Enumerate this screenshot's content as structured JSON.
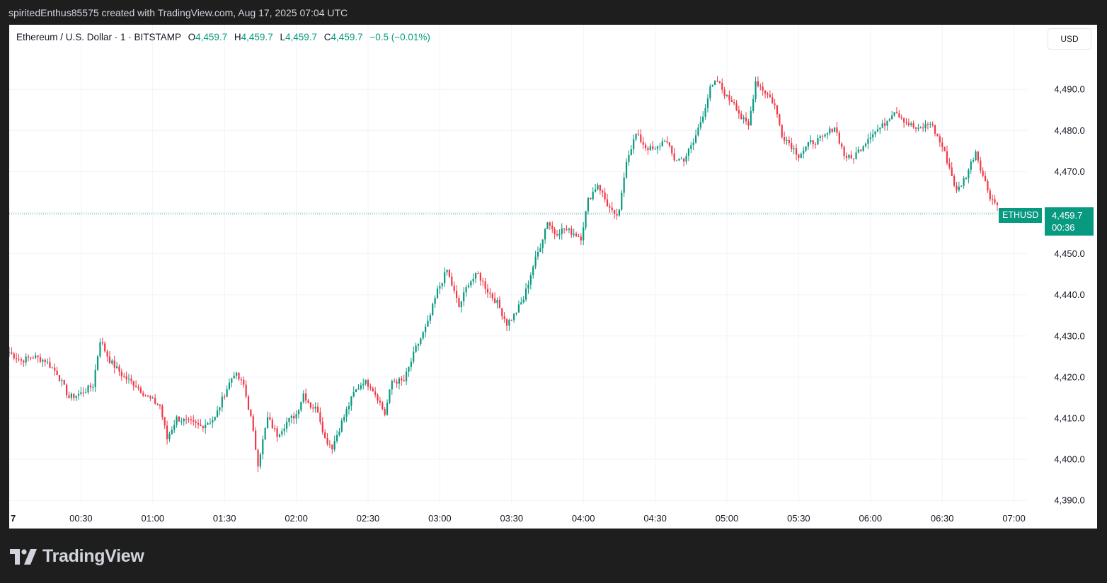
{
  "header": {
    "caption": "spiritedEnthus85575 created with TradingView.com, Aug 17, 2025 07:04 UTC"
  },
  "legend": {
    "symbol": "Ethereum / U.S. Dollar · 1 · BITSTAMP",
    "open_label": "O",
    "open": "4,459.7",
    "high_label": "H",
    "high": "4,459.7",
    "low_label": "L",
    "low": "4,459.7",
    "close_label": "C",
    "close": "4,459.7",
    "change": "−0.5 (−0.01%)"
  },
  "currency": "USD",
  "last_price": {
    "symbol": "ETHUSD",
    "price": "4,459.7",
    "countdown": "00:36"
  },
  "footer": {
    "brand": "TradingView"
  },
  "colors": {
    "up": "#089981",
    "down": "#f23645",
    "grid": "#f0f3fa",
    "axis_text": "#131722"
  },
  "chart_data": {
    "type": "candlestick",
    "x_unit": "UTC time",
    "time_labels": [
      "7",
      "00:30",
      "01:00",
      "01:30",
      "02:00",
      "02:30",
      "03:00",
      "03:30",
      "04:00",
      "04:30",
      "05:00",
      "05:30",
      "06:00",
      "06:30",
      "07:00"
    ],
    "y_ticks": [
      4390,
      4400,
      4410,
      4420,
      4430,
      4440,
      4450,
      4460,
      4470,
      4480,
      4490
    ],
    "y_tick_labels": [
      "4,390.0",
      "4,400.0",
      "4,410.0",
      "4,420.0",
      "4,430.0",
      "4,440.0",
      "4,450.0",
      "4,460.0",
      "4,470.0",
      "4,480.0",
      "4,490.0"
    ],
    "ylim": [
      4388,
      4497
    ],
    "last_price": 4459.7,
    "close_path": [
      [
        "00:00",
        4426
      ],
      [
        "00:05",
        4424
      ],
      [
        "00:10",
        4425
      ],
      [
        "00:15",
        4424
      ],
      [
        "00:20",
        4421
      ],
      [
        "00:25",
        4415
      ],
      [
        "00:30",
        4416
      ],
      [
        "00:35",
        4418
      ],
      [
        "00:38",
        4429
      ],
      [
        "00:42",
        4424
      ],
      [
        "00:48",
        4420
      ],
      [
        "00:53",
        4418
      ],
      [
        "00:58",
        4415
      ],
      [
        "01:03",
        4413
      ],
      [
        "01:06",
        4405
      ],
      [
        "01:10",
        4410
      ],
      [
        "01:15",
        4409
      ],
      [
        "01:20",
        4408
      ],
      [
        "01:26",
        4410
      ],
      [
        "01:30",
        4416
      ],
      [
        "01:34",
        4421
      ],
      [
        "01:38",
        4418
      ],
      [
        "01:41",
        4410
      ],
      [
        "01:44",
        4399
      ],
      [
        "01:48",
        4410
      ],
      [
        "01:52",
        4406
      ],
      [
        "01:56",
        4409
      ],
      [
        "02:00",
        4411
      ],
      [
        "02:03",
        4416
      ],
      [
        "02:06",
        4413
      ],
      [
        "02:09",
        4412
      ],
      [
        "02:12",
        4405
      ],
      [
        "02:15",
        4403
      ],
      [
        "02:19",
        4409
      ],
      [
        "02:24",
        4416
      ],
      [
        "02:28",
        4419
      ],
      [
        "02:31",
        4418
      ],
      [
        "02:34",
        4415
      ],
      [
        "02:37",
        4411
      ],
      [
        "02:40",
        4419
      ],
      [
        "02:45",
        4419
      ],
      [
        "02:50",
        4427
      ],
      [
        "02:55",
        4433
      ],
      [
        "02:59",
        4441
      ],
      [
        "03:03",
        4446
      ],
      [
        "03:08",
        4437
      ],
      [
        "03:12",
        4443
      ],
      [
        "03:16",
        4445
      ],
      [
        "03:20",
        4441
      ],
      [
        "03:24",
        4438
      ],
      [
        "03:28",
        4433
      ],
      [
        "03:31",
        4435
      ],
      [
        "03:35",
        4439
      ],
      [
        "03:39",
        4447
      ],
      [
        "03:42",
        4452
      ],
      [
        "03:45",
        4458
      ],
      [
        "03:48",
        4455
      ],
      [
        "03:52",
        4456
      ],
      [
        "03:56",
        4455
      ],
      [
        "03:59",
        4454
      ],
      [
        "04:02",
        4463
      ],
      [
        "04:06",
        4467
      ],
      [
        "04:10",
        4462
      ],
      [
        "04:13",
        4459
      ],
      [
        "04:15",
        4460
      ],
      [
        "04:18",
        4473
      ],
      [
        "04:22",
        4479
      ],
      [
        "04:26",
        4476
      ],
      [
        "04:30",
        4475
      ],
      [
        "04:34",
        4478
      ],
      [
        "04:38",
        4473
      ],
      [
        "04:42",
        4473
      ],
      [
        "04:46",
        4477
      ],
      [
        "04:50",
        4484
      ],
      [
        "04:53",
        4490
      ],
      [
        "04:56",
        4492
      ],
      [
        "05:00",
        4488
      ],
      [
        "05:03",
        4487
      ],
      [
        "05:06",
        4483
      ],
      [
        "05:09",
        4481
      ],
      [
        "05:12",
        4492
      ],
      [
        "05:15",
        4490
      ],
      [
        "05:18",
        4488
      ],
      [
        "05:20",
        4486
      ],
      [
        "05:23",
        4479
      ],
      [
        "05:26",
        4477
      ],
      [
        "05:30",
        4474
      ],
      [
        "05:35",
        4477
      ],
      [
        "05:40",
        4478
      ],
      [
        "05:45",
        4481
      ],
      [
        "05:49",
        4474
      ],
      [
        "05:52",
        4473
      ],
      [
        "05:55",
        4475
      ],
      [
        "06:00",
        4479
      ],
      [
        "06:05",
        4481
      ],
      [
        "06:10",
        4485
      ],
      [
        "06:15",
        4482
      ],
      [
        "06:20",
        4480
      ],
      [
        "06:25",
        4482
      ],
      [
        "06:30",
        4476
      ],
      [
        "06:33",
        4471
      ],
      [
        "06:36",
        4465
      ],
      [
        "06:40",
        4469
      ],
      [
        "06:44",
        4475
      ],
      [
        "06:47",
        4469
      ],
      [
        "06:50",
        4464
      ],
      [
        "06:54",
        4461
      ],
      [
        "06:57",
        4460
      ],
      [
        "07:00",
        4459.7
      ]
    ]
  }
}
